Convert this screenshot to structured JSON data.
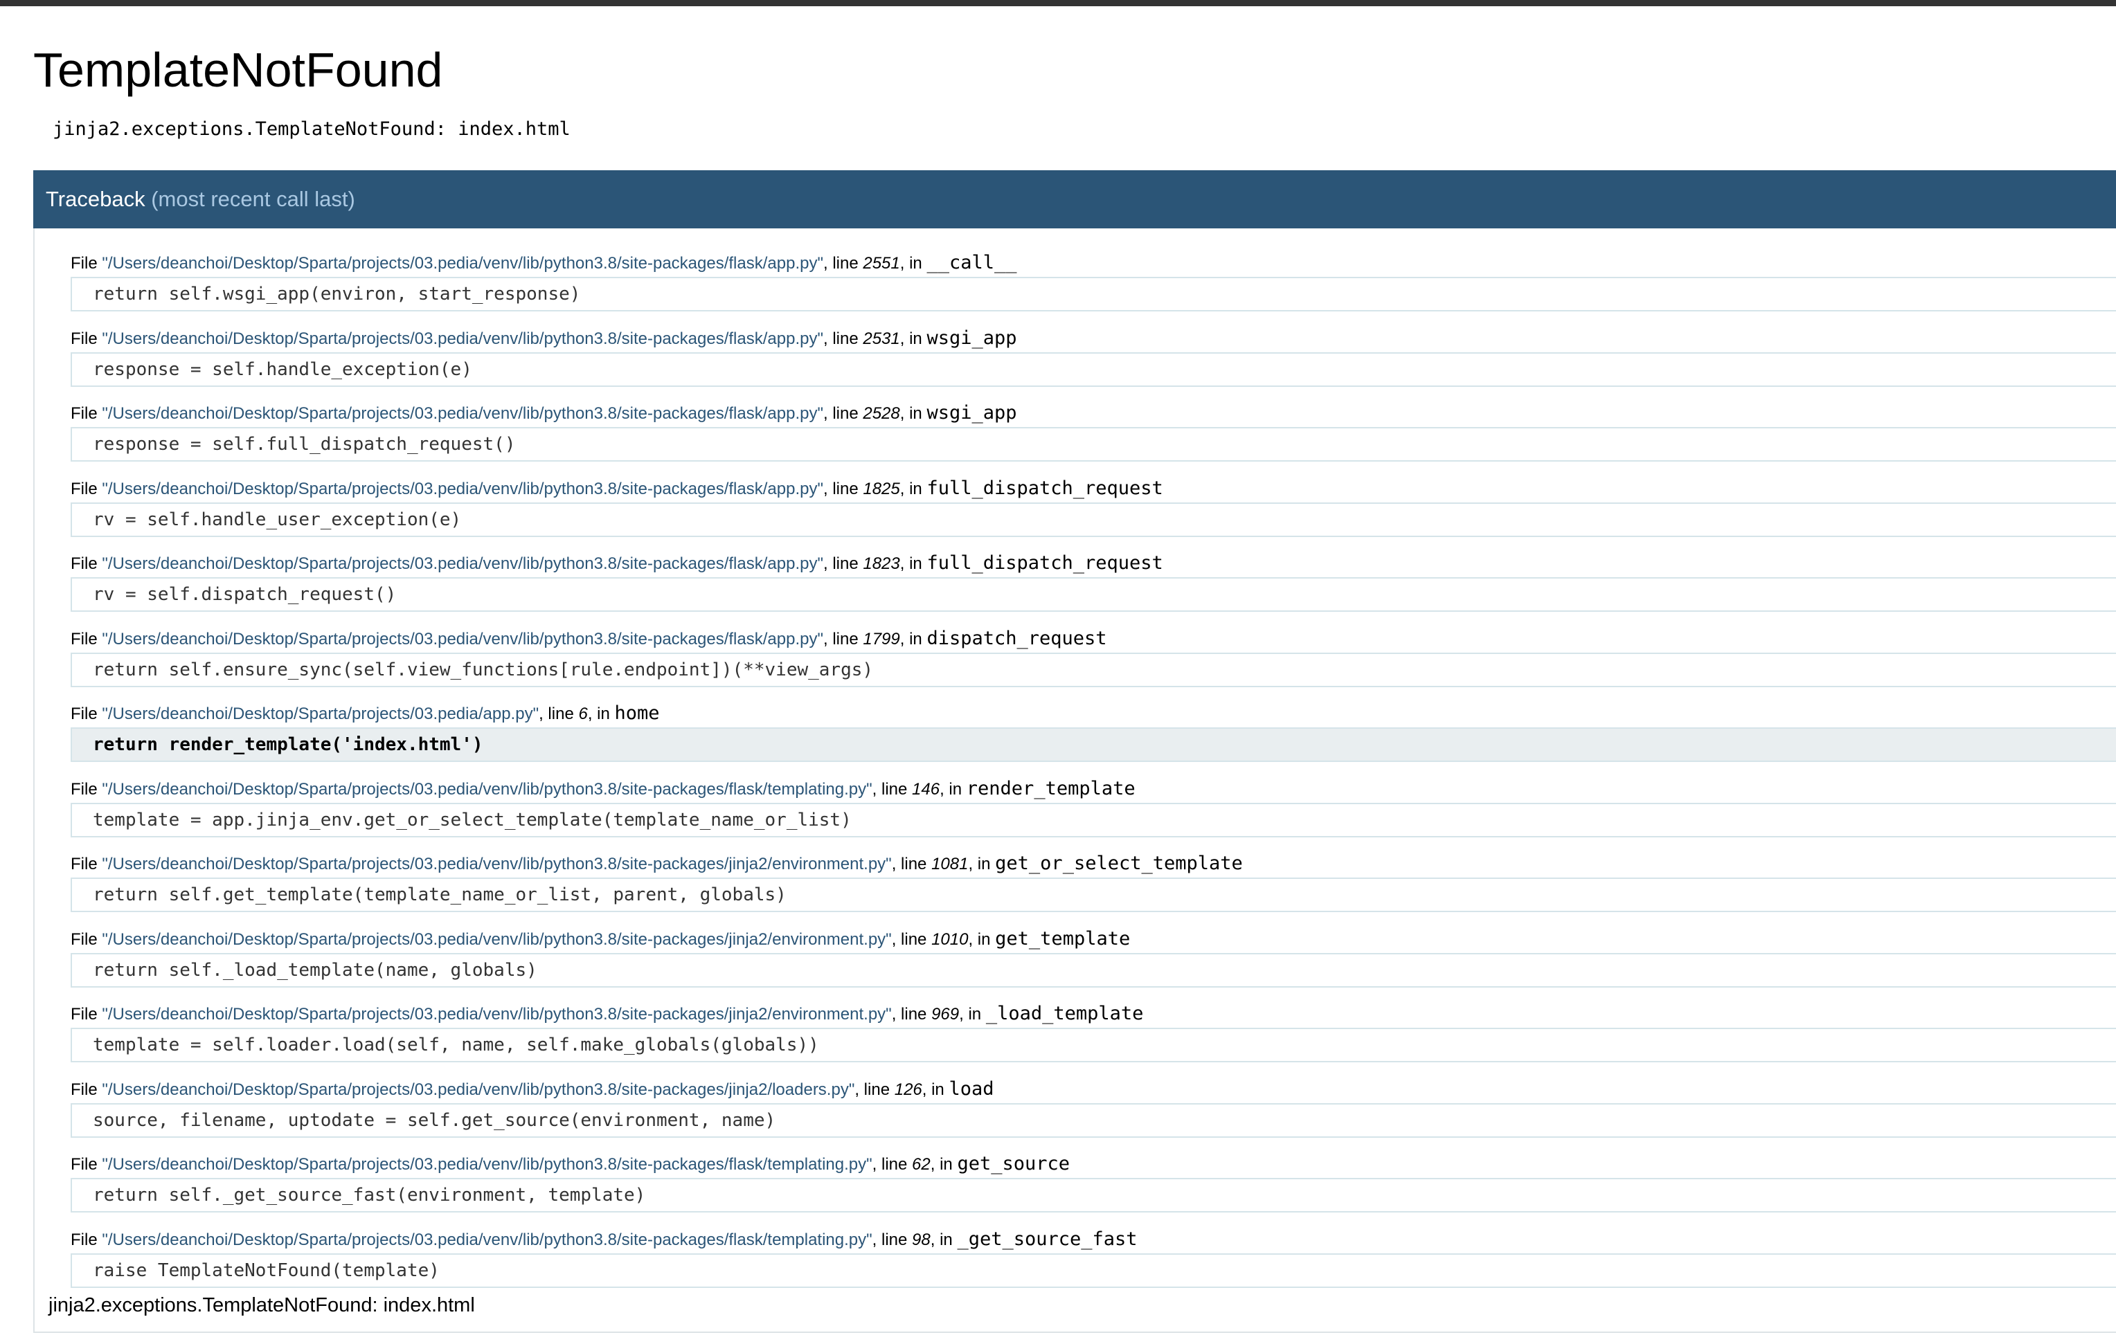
{
  "title": "TemplateNotFound",
  "error_message": "jinja2.exceptions.TemplateNotFound: index.html",
  "traceback": {
    "label": "Traceback",
    "sublabel": "(most recent call last)"
  },
  "file_prefix": "File ",
  "line_prefix": ", line ",
  "in_prefix": ", in ",
  "frames": [
    {
      "file": "\"/Users/deanchoi/Desktop/Sparta/projects/03.pedia/venv/lib/python3.8/site-packages/flask/app.py\"",
      "line": "2551",
      "func": "__call__",
      "code": "return self.wsgi_app(environ, start_response)",
      "current": false
    },
    {
      "file": "\"/Users/deanchoi/Desktop/Sparta/projects/03.pedia/venv/lib/python3.8/site-packages/flask/app.py\"",
      "line": "2531",
      "func": "wsgi_app",
      "code": "response = self.handle_exception(e)",
      "current": false
    },
    {
      "file": "\"/Users/deanchoi/Desktop/Sparta/projects/03.pedia/venv/lib/python3.8/site-packages/flask/app.py\"",
      "line": "2528",
      "func": "wsgi_app",
      "code": "response = self.full_dispatch_request()",
      "current": false
    },
    {
      "file": "\"/Users/deanchoi/Desktop/Sparta/projects/03.pedia/venv/lib/python3.8/site-packages/flask/app.py\"",
      "line": "1825",
      "func": "full_dispatch_request",
      "code": "rv = self.handle_user_exception(e)",
      "current": false
    },
    {
      "file": "\"/Users/deanchoi/Desktop/Sparta/projects/03.pedia/venv/lib/python3.8/site-packages/flask/app.py\"",
      "line": "1823",
      "func": "full_dispatch_request",
      "code": "rv = self.dispatch_request()",
      "current": false
    },
    {
      "file": "\"/Users/deanchoi/Desktop/Sparta/projects/03.pedia/venv/lib/python3.8/site-packages/flask/app.py\"",
      "line": "1799",
      "func": "dispatch_request",
      "code": "return self.ensure_sync(self.view_functions[rule.endpoint])(**view_args)",
      "current": false
    },
    {
      "file": "\"/Users/deanchoi/Desktop/Sparta/projects/03.pedia/app.py\"",
      "line": "6",
      "func": "home",
      "code": "return render_template('index.html')",
      "current": true
    },
    {
      "file": "\"/Users/deanchoi/Desktop/Sparta/projects/03.pedia/venv/lib/python3.8/site-packages/flask/templating.py\"",
      "line": "146",
      "func": "render_template",
      "code": "template = app.jinja_env.get_or_select_template(template_name_or_list)",
      "current": false
    },
    {
      "file": "\"/Users/deanchoi/Desktop/Sparta/projects/03.pedia/venv/lib/python3.8/site-packages/jinja2/environment.py\"",
      "line": "1081",
      "func": "get_or_select_template",
      "code": "return self.get_template(template_name_or_list, parent, globals)",
      "current": false
    },
    {
      "file": "\"/Users/deanchoi/Desktop/Sparta/projects/03.pedia/venv/lib/python3.8/site-packages/jinja2/environment.py\"",
      "line": "1010",
      "func": "get_template",
      "code": "return self._load_template(name, globals)",
      "current": false
    },
    {
      "file": "\"/Users/deanchoi/Desktop/Sparta/projects/03.pedia/venv/lib/python3.8/site-packages/jinja2/environment.py\"",
      "line": "969",
      "func": "_load_template",
      "code": "template = self.loader.load(self, name, self.make_globals(globals))",
      "current": false
    },
    {
      "file": "\"/Users/deanchoi/Desktop/Sparta/projects/03.pedia/venv/lib/python3.8/site-packages/jinja2/loaders.py\"",
      "line": "126",
      "func": "load",
      "code": "source, filename, uptodate = self.get_source(environment, name)",
      "current": false
    },
    {
      "file": "\"/Users/deanchoi/Desktop/Sparta/projects/03.pedia/venv/lib/python3.8/site-packages/flask/templating.py\"",
      "line": "62",
      "func": "get_source",
      "code": "return self._get_source_fast(environment, template)",
      "current": false
    },
    {
      "file": "\"/Users/deanchoi/Desktop/Sparta/projects/03.pedia/venv/lib/python3.8/site-packages/flask/templating.py\"",
      "line": "98",
      "func": "_get_source_fast",
      "code": "raise TemplateNotFound(template)",
      "current": false
    }
  ],
  "final_error": "jinja2.exceptions.TemplateNotFound: index.html",
  "colors": {
    "header_bg": "#2b5577",
    "header_sub": "#aac8e2",
    "filename": "#2b5577",
    "current_bg": "#e9eef0"
  }
}
